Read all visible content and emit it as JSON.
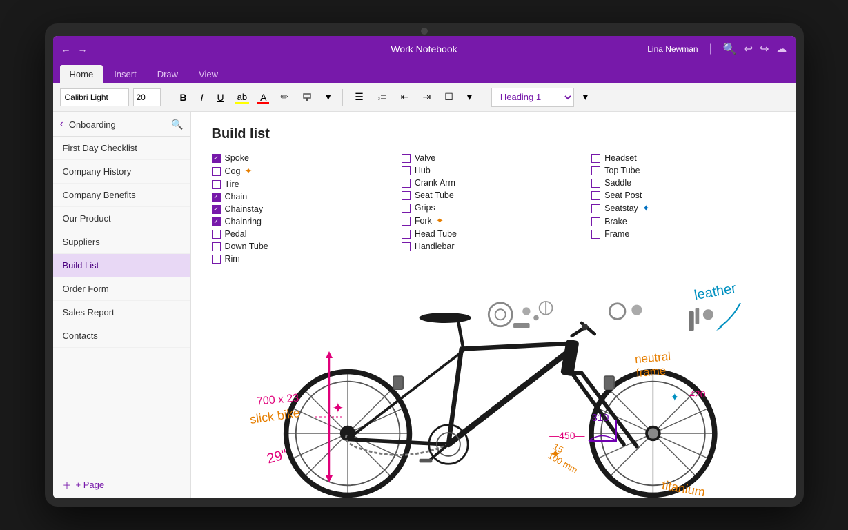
{
  "titleBar": {
    "back": "←",
    "forward": "→",
    "title": "Work Notebook",
    "user": "Lina Newman",
    "divider": "|",
    "icons": [
      "🔍",
      "↩",
      "↪",
      "☁"
    ]
  },
  "ribbon": {
    "tabs": [
      "Home",
      "Insert",
      "Draw",
      "View"
    ],
    "activeTab": "Home",
    "font": "Calibri Light",
    "fontSize": "20",
    "buttons": {
      "bold": "B",
      "italic": "I",
      "underline": "U",
      "highlight": "ab",
      "fontColor": "A",
      "eraser": "✏",
      "moreFormat": "▾"
    },
    "listButtons": [
      "≡",
      "1≡",
      "←≡",
      "→≡",
      "☐"
    ],
    "heading": "Heading 1",
    "headingArrow": "▾"
  },
  "sidebar": {
    "title": "Onboarding",
    "items": [
      "First Day Checklist",
      "Company History",
      "Company Benefits",
      "Our Product",
      "Suppliers",
      "Build List",
      "Order Form",
      "Sales Report",
      "Contacts"
    ],
    "activeItem": "Build List",
    "addPage": "+ Page"
  },
  "page": {
    "title": "Build list",
    "checklistColumns": [
      [
        {
          "label": "Spoke",
          "checked": true
        },
        {
          "label": "Cog",
          "checked": false,
          "star": "orange"
        },
        {
          "label": "Tire",
          "checked": false
        },
        {
          "label": "Chain",
          "checked": true
        },
        {
          "label": "Chainstay",
          "checked": true
        },
        {
          "label": "Chainring",
          "checked": true
        },
        {
          "label": "Pedal",
          "checked": false
        },
        {
          "label": "Down Tube",
          "checked": false
        },
        {
          "label": "Rim",
          "checked": false
        }
      ],
      [
        {
          "label": "Valve",
          "checked": false
        },
        {
          "label": "Hub",
          "checked": false
        },
        {
          "label": "Crank Arm",
          "checked": false
        },
        {
          "label": "Seat Tube",
          "checked": false
        },
        {
          "label": "Grips",
          "checked": false
        },
        {
          "label": "Fork",
          "checked": false,
          "star": "orange"
        },
        {
          "label": "Head Tube",
          "checked": false
        },
        {
          "label": "Handlebar",
          "checked": false
        }
      ],
      [
        {
          "label": "Headset",
          "checked": false
        },
        {
          "label": "Top Tube",
          "checked": false
        },
        {
          "label": "Saddle",
          "checked": false
        },
        {
          "label": "Seat Post",
          "checked": false
        },
        {
          "label": "Seatstay",
          "checked": false,
          "star": "blue"
        },
        {
          "label": "Brake",
          "checked": false
        },
        {
          "label": "Frame",
          "checked": false
        }
      ]
    ],
    "annotations": {
      "leather": "leather",
      "neutralFrame": "neutral\nframe",
      "slickBike": "slick bike",
      "dimensions": "700 x 23",
      "height": "29\"",
      "titanium": "titanium",
      "angle": "310",
      "width450": "450",
      "length420": "420",
      "length15": "15",
      "length100": "100 mm"
    }
  }
}
